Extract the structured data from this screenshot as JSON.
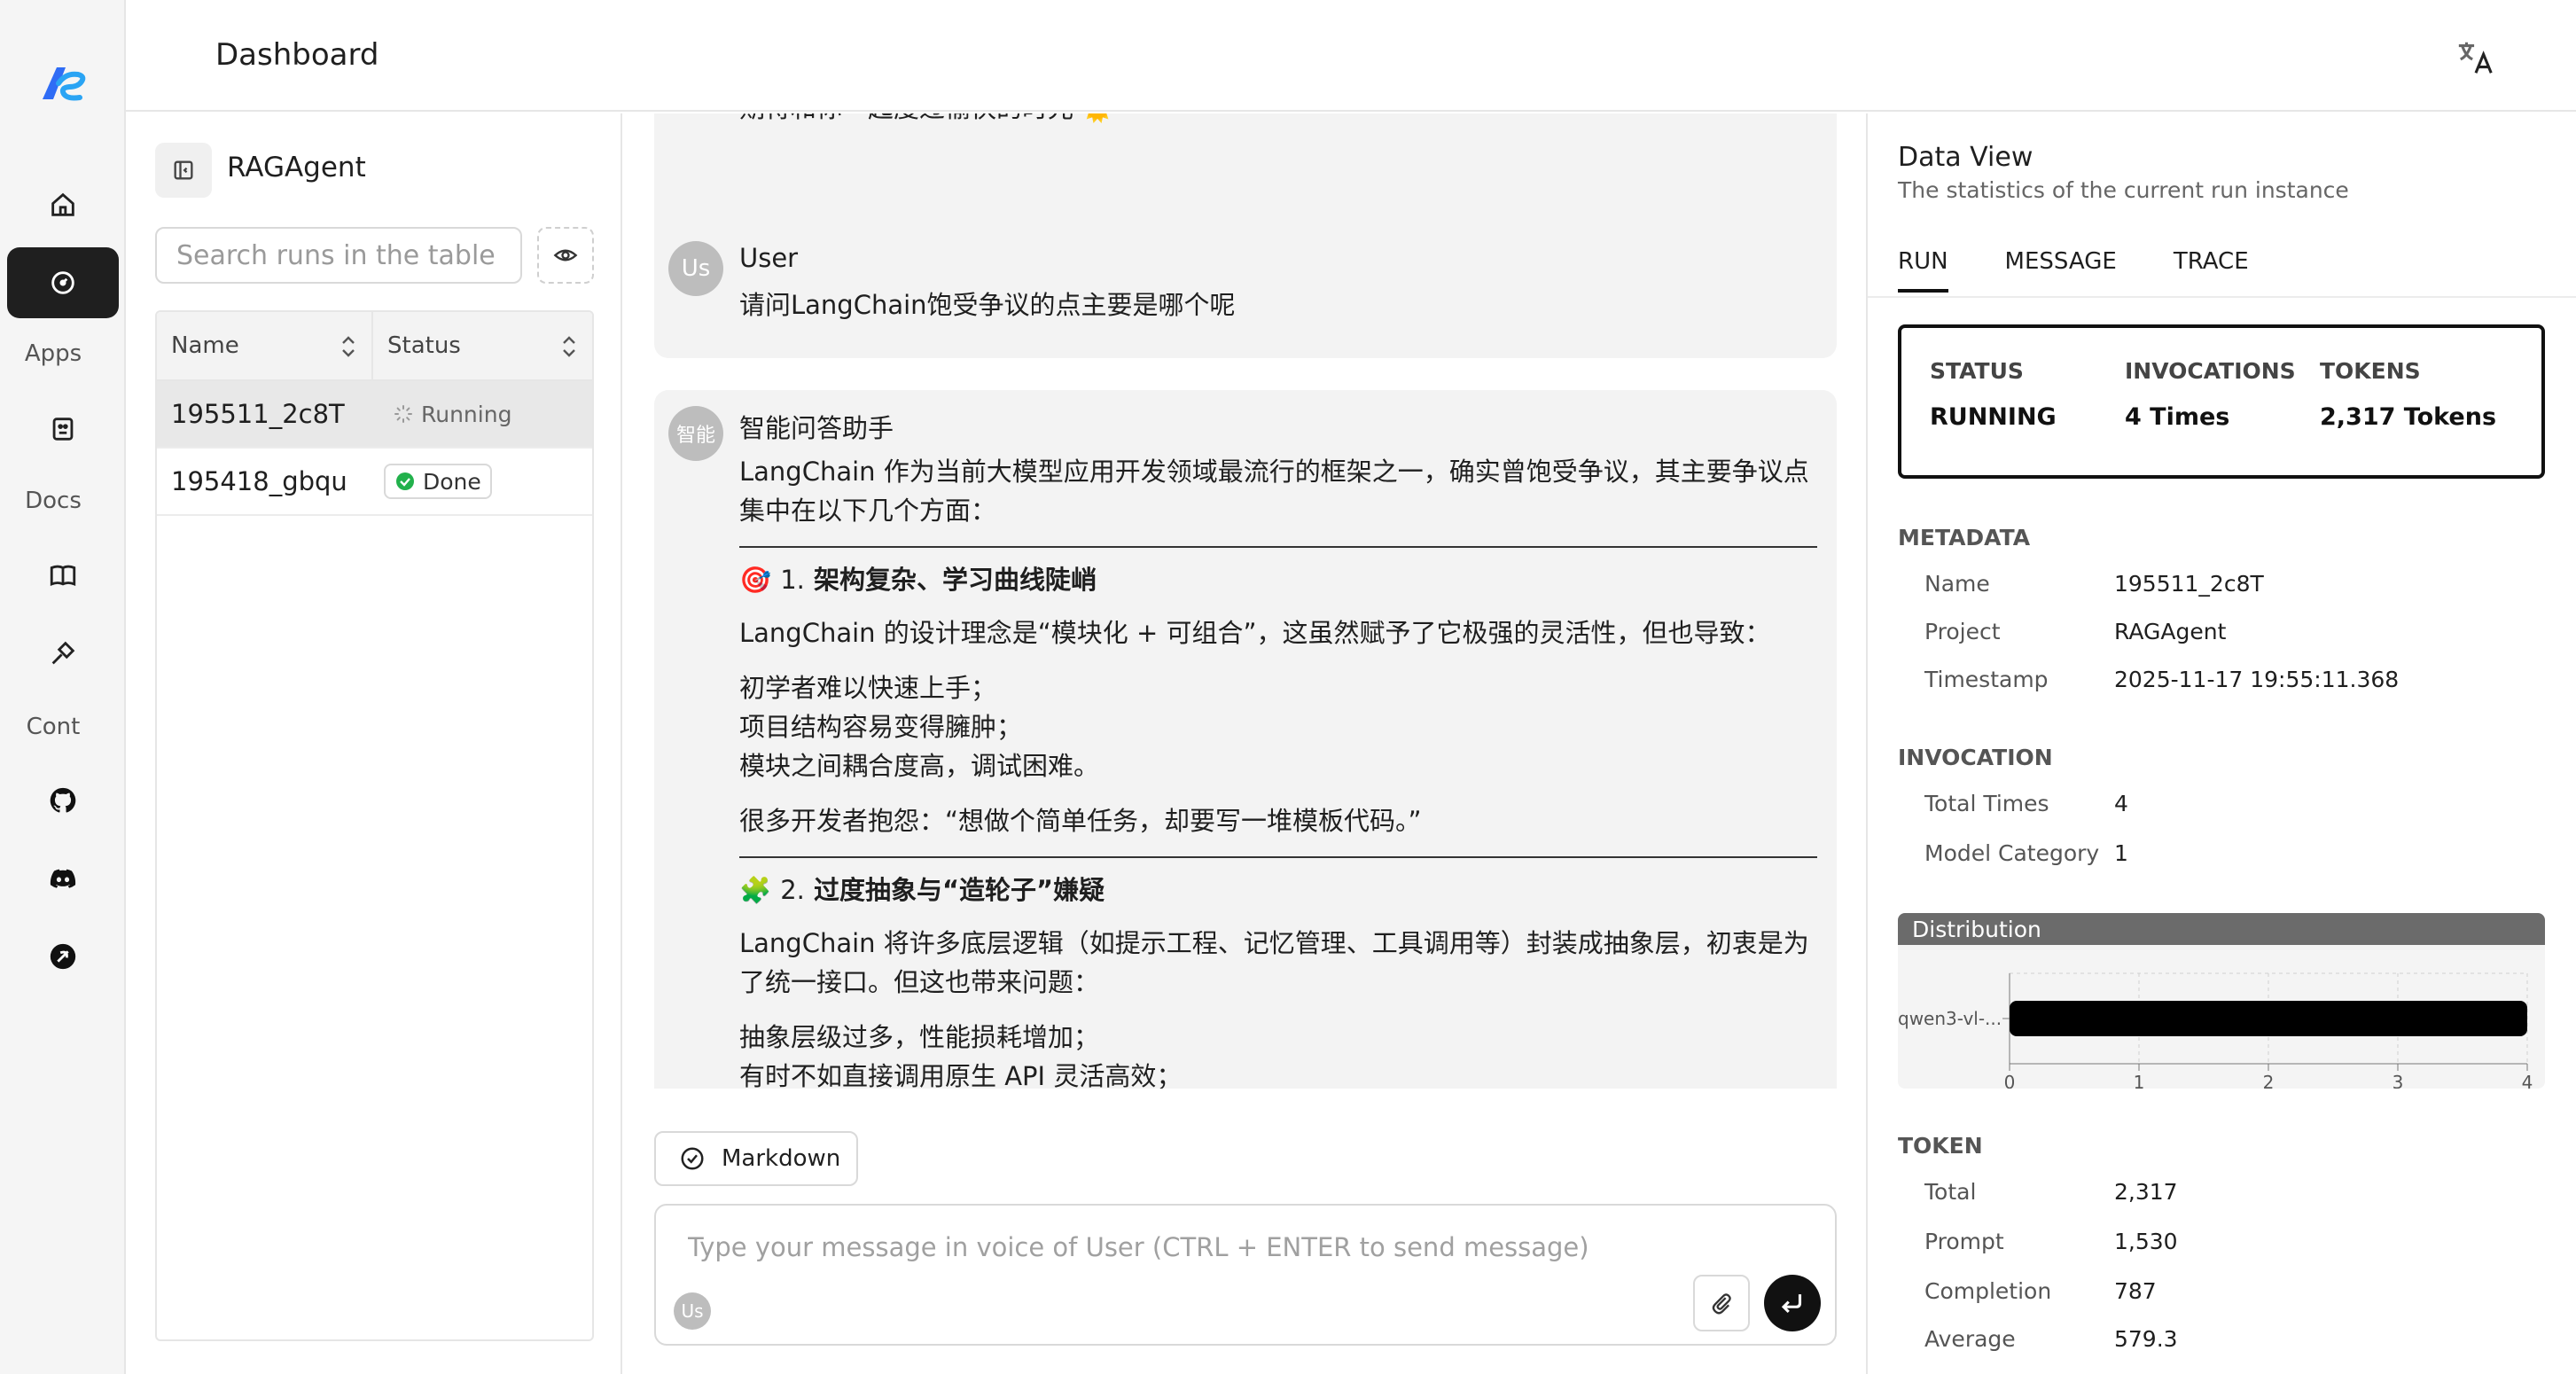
{
  "rail": {
    "sections": [
      "Apps",
      "Docs",
      "Cont"
    ]
  },
  "header": {
    "title": "Dashboard"
  },
  "runs": {
    "agent_name": "RAGAgent",
    "search_placeholder": "Search runs in the table",
    "columns": [
      "Name",
      "Status"
    ],
    "rows": [
      {
        "name": "195511_2c8T",
        "status": "Running"
      },
      {
        "name": "195418_gbqu",
        "status": "Done"
      }
    ]
  },
  "chat": {
    "prev_text": "期待和你一起度过愉快的时光 🌞",
    "user_msg": {
      "avatar": "Us",
      "sender": "User",
      "text": "请问LangChain饱受争议的点主要是哪个呢"
    },
    "bot_msg": {
      "avatar": "智能",
      "sender": "智能问答助手",
      "intro": "LangChain 作为当前大模型应用开发领域最流行的框架之一，确实曾饱受争议，其主要争议点集中在以下几个方面：",
      "s1_icon": "🎯",
      "s1_num": "1.",
      "s1_title": "架构复杂、学习曲线陡峭",
      "s1_p": "LangChain 的设计理念是“模块化 + 可组合”，这虽然赋予了它极强的灵活性，但也导致：",
      "s1_l1": "初学者难以快速上手；",
      "s1_l2": "项目结构容易变得臃肿；",
      "s1_l3": "模块之间耦合度高，调试困难。",
      "s1_quote": "很多开发者抱怨：“想做个简单任务，却要写一堆模板代码。”",
      "s2_icon": "🧩",
      "s2_num": "2.",
      "s2_title": "过度抽象与“造轮子”嫌疑",
      "s2_p": "LangChain 将许多底层逻辑（如提示工程、记忆管理、工具调用等）封装成抽象层，初衷是为了统一接口。但这也带来问题：",
      "s2_l1": "抽象层级过多，性能损耗增加；",
      "s2_l2": "有时不如直接调用原生 API 灵活高效；"
    },
    "markdown_label": "Markdown",
    "input_placeholder": "Type your message in voice of User (CTRL + ENTER to send message)",
    "composer_avatar": "Us"
  },
  "data_view": {
    "title": "Data View",
    "subtitle": "The statistics of the current run instance",
    "tabs": [
      "RUN",
      "MESSAGE",
      "TRACE"
    ],
    "stats": [
      {
        "label": "STATUS",
        "value": "RUNNING"
      },
      {
        "label": "INVOCATIONS",
        "value": "4 Times"
      },
      {
        "label": "TOKENS",
        "value": "2,317 Tokens"
      }
    ],
    "metadata": {
      "heading": "METADATA",
      "rows": [
        {
          "key": "Name",
          "value": "195511_2c8T"
        },
        {
          "key": "Project",
          "value": "RAGAgent"
        },
        {
          "key": "Timestamp",
          "value": "2025-11-17 19:55:11.368"
        }
      ]
    },
    "invocation": {
      "heading": "INVOCATION",
      "rows": [
        {
          "key": "Total Times",
          "value": "4"
        },
        {
          "key": "Model Category",
          "value": "1"
        }
      ]
    },
    "token": {
      "heading": "TOKEN",
      "rows": [
        {
          "key": "Total",
          "value": "2,317"
        },
        {
          "key": "Prompt",
          "value": "1,530"
        },
        {
          "key": "Completion",
          "value": "787"
        },
        {
          "key": "Average",
          "value": "579.3"
        }
      ]
    },
    "distribution_title": "Distribution"
  },
  "chart_data": {
    "type": "bar",
    "orientation": "horizontal",
    "categories": [
      "qwen3-vl-..."
    ],
    "values": [
      4
    ],
    "xlim": [
      0,
      4
    ],
    "xticks": [
      "0",
      "1",
      "2",
      "3",
      "4"
    ],
    "grid": true
  }
}
